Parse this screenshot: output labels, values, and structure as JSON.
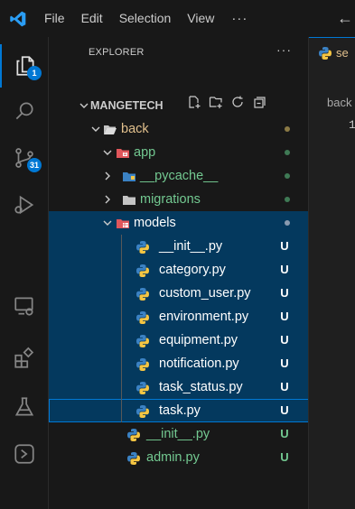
{
  "menu": {
    "items": [
      "File",
      "Edit",
      "Selection",
      "View"
    ],
    "more": "···",
    "nav_back": "←"
  },
  "activity_bar": {
    "explorer_badge": "1",
    "scm_badge": "31"
  },
  "sidebar": {
    "title": "EXPLORER",
    "more": "···",
    "project": "MANGETECH",
    "tree": [
      {
        "label": "back",
        "kind": "folder-open",
        "git": "m",
        "status": "",
        "dot": "#8b7a45"
      },
      {
        "label": "app",
        "kind": "folder-app",
        "git": "u",
        "status": "",
        "dot": "#3f7a55"
      },
      {
        "label": "__pycache__",
        "kind": "folder-py",
        "git": "u",
        "status": "",
        "dot": "#3f7a55"
      },
      {
        "label": "migrations",
        "kind": "folder",
        "git": "u",
        "status": "",
        "dot": "#3f7a55"
      },
      {
        "label": "models",
        "kind": "folder-models",
        "git": "plain",
        "status": "",
        "dot": "#8a9bb0"
      },
      {
        "label": "__init__.py",
        "kind": "py",
        "git": "plain",
        "status": "U"
      },
      {
        "label": "category.py",
        "kind": "py",
        "git": "plain",
        "status": "U"
      },
      {
        "label": "custom_user.py",
        "kind": "py",
        "git": "plain",
        "status": "U"
      },
      {
        "label": "environment.py",
        "kind": "py",
        "git": "plain",
        "status": "U"
      },
      {
        "label": "equipment.py",
        "kind": "py",
        "git": "plain",
        "status": "U"
      },
      {
        "label": "notification.py",
        "kind": "py",
        "git": "plain",
        "status": "U"
      },
      {
        "label": "task_status.py",
        "kind": "py",
        "git": "plain",
        "status": "U"
      },
      {
        "label": "task.py",
        "kind": "py",
        "git": "plain",
        "status": "U"
      },
      {
        "label": "__init__.py",
        "kind": "py",
        "git": "u",
        "status": "U"
      },
      {
        "label": "admin.py",
        "kind": "py",
        "git": "u",
        "status": "U"
      }
    ]
  },
  "editor": {
    "tab_label": "se",
    "breadcrumb": "back",
    "line_number": "1"
  }
}
